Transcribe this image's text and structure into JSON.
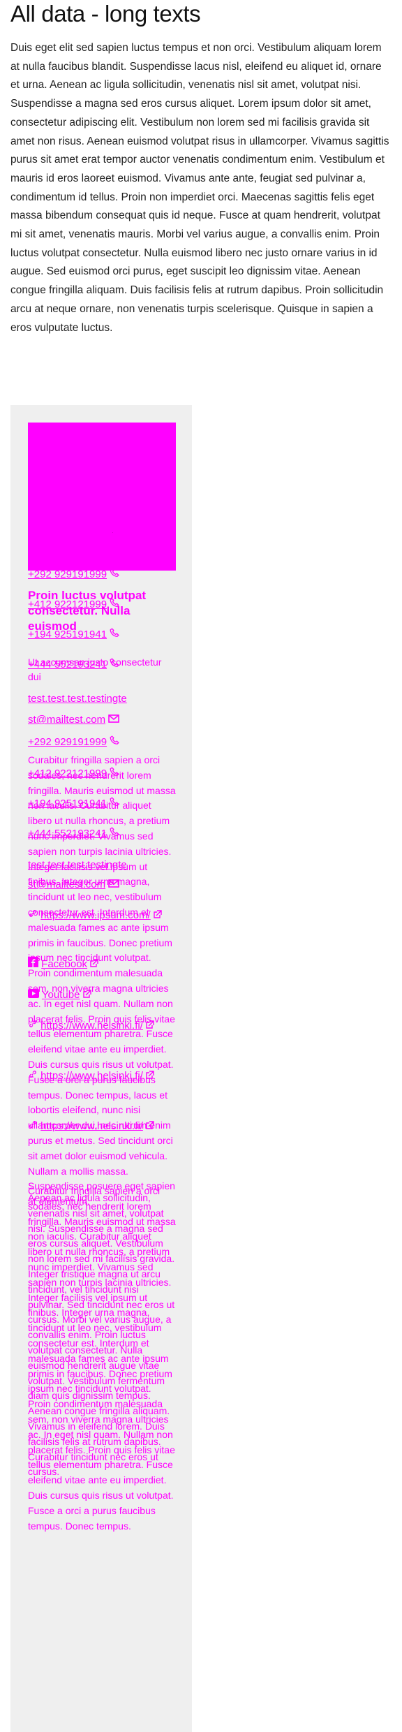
{
  "page": {
    "title": "All data - long texts",
    "intro": "Duis eget elit sed sapien luctus tempus et non orci. Vestibulum aliquam lorem at nulla faucibus blandit. Suspendisse lacus nisl, eleifend eu aliquet id, ornare et urna. Aenean ac ligula sollicitudin, venenatis nisl sit amet, volutpat nisi. Suspendisse a magna sed eros cursus aliquet. Lorem ipsum dolor sit amet, consectetur adipiscing elit. Vestibulum non lorem sed mi facilisis gravida sit amet non risus. Aenean euismod volutpat risus in ullamcorper. Vivamus sagittis purus sit amet erat tempor auctor venenatis condimentum enim. Vestibulum et mauris id eros laoreet euismod. Vivamus ante ante, feugiat sed pulvinar a, condimentum id tellus. Proin non imperdiet orci. Maecenas sagittis felis eget massa bibendum consequat quis id neque. Fusce at quam hendrerit, volutpat mi sit amet, venenatis mauris. Morbi vel varius augue, a convallis enim. Proin luctus volutpat consectetur. Nulla euismod libero nec justo ornare varius in id augue. Sed euismod orci purus, eget suscipit leo dignissim vitae. Aenean congue fringilla aliquam. Duis facilisis felis at rutrum dapibus. Proin sollicitudin arcu at neque ornare, non venenatis turpis scelerisque. Quisque in sapien a eros vulputate luctus."
  },
  "card": {
    "phones_a": [
      "+292 929191999",
      "+412 922121999",
      "+194 925191941",
      "+444 552193241"
    ],
    "heading": "Proin luctus volutpat consectetur. Nulla euismod",
    "subtitle": "Ut accumsan justo consectetur dui",
    "weblink_text": "test.test.test.testingte",
    "email": "st@mailtest.com",
    "phones_b": [
      "+292 929191999",
      "+412 922121999",
      "+194 925191941",
      "+444 552193241"
    ],
    "web_url": "https://www.ipsum.com/",
    "facebook": "Facebook",
    "youtube": "Youtube",
    "helsinki_urls": [
      "https://www.helsinki.fi/",
      "https://www.helsinki.fi/",
      "https://www.helsinki.fi/"
    ],
    "desc": "Curabitur fringilla sapien a orci sodales, nec hendrerit lorem fringilla. Mauris euismod ut massa non iaculis. Curabitur aliquet libero ut nulla rhoncus, a pretium nunc imperdiet. Vivamus sed sapien non turpis lacinia ultricies. Integer facilisis vel ipsum ut finibus. Integer urna magna, tincidunt ut leo nec, vestibulum consectetur est. Interdum et malesuada fames ac ante ipsum primis in faucibus. Donec pretium ipsum nec tincidunt volutpat. Proin condimentum malesuada sem, non viverra magna ultricies ac. In eget nisl quam. Nullam non placerat felis. Proin quis felis vitae tellus elementum pharetra. Fusce eleifend vitae ante eu imperdiet. Duis cursus quis risus ut volutpat. Fusce a orci a purus faucibus tempus. Donec tempus, lacus et lobortis eleifend, nunc nisi ullamcorper dui, nec rutrum enim purus et metus. Sed tincidunt orci sit amet dolor euismod vehicula. Nullam a mollis massa. Suspendisse posuere eget sapien at elementum.",
    "desc2": "Curabitur fringilla sapien a orci sodales, nec hendrerit lorem fringilla. Mauris euismod ut massa non iaculis. Curabitur aliquet libero ut nulla rhoncus, a pretium nunc imperdiet. Vivamus sed sapien non turpis lacinia ultricies. Integer facilisis vel ipsum ut finibus. Integer urna magna, tincidunt ut leo nec, vestibulum consectetur est. Interdum et malesuada fames ac ante ipsum primis in faucibus. Donec pretium ipsum nec tincidunt volutpat. Proin condimentum malesuada sem, non viverra magna ultricies ac. In eget nisl quam. Nullam non placerat felis. Proin quis felis vitae tellus elementum pharetra. Fusce eleifend vitae ante eu imperdiet. Duis cursus quis risus ut volutpat. Fusce a orci a purus faucibus tempus. Donec tempus.",
    "desc3": "Aenean ac ligula sollicitudin, venenatis nisl sit amet, volutpat nisi. Suspendisse a magna sed eros cursus aliquet. Vestibulum non lorem sed mi facilisis gravida. Integer tristique magna ut arcu tincidunt, vel tincidunt nisi pulvinar. Sed tincidunt nec eros ut cursus. Morbi vel varius augue, a convallis enim. Proin luctus volutpat consectetur. Nulla euismod hendrerit augue vitae volutpat. Vestibulum fermentum diam quis dignissim tempus. Aenean congue fringilla aliquam. Vivamus in eleifend lorem. Duis facilisis felis at rutrum dapibus. Curabitur tincidunt nec eros ut cursus."
  },
  "colors": {
    "accent": "#ff00ff",
    "card_bg": "#efefef",
    "text": "#1a1a1a"
  },
  "icons": [
    "phone-icon",
    "mail-icon",
    "link-icon",
    "external-link-icon",
    "facebook-icon",
    "youtube-icon"
  ]
}
